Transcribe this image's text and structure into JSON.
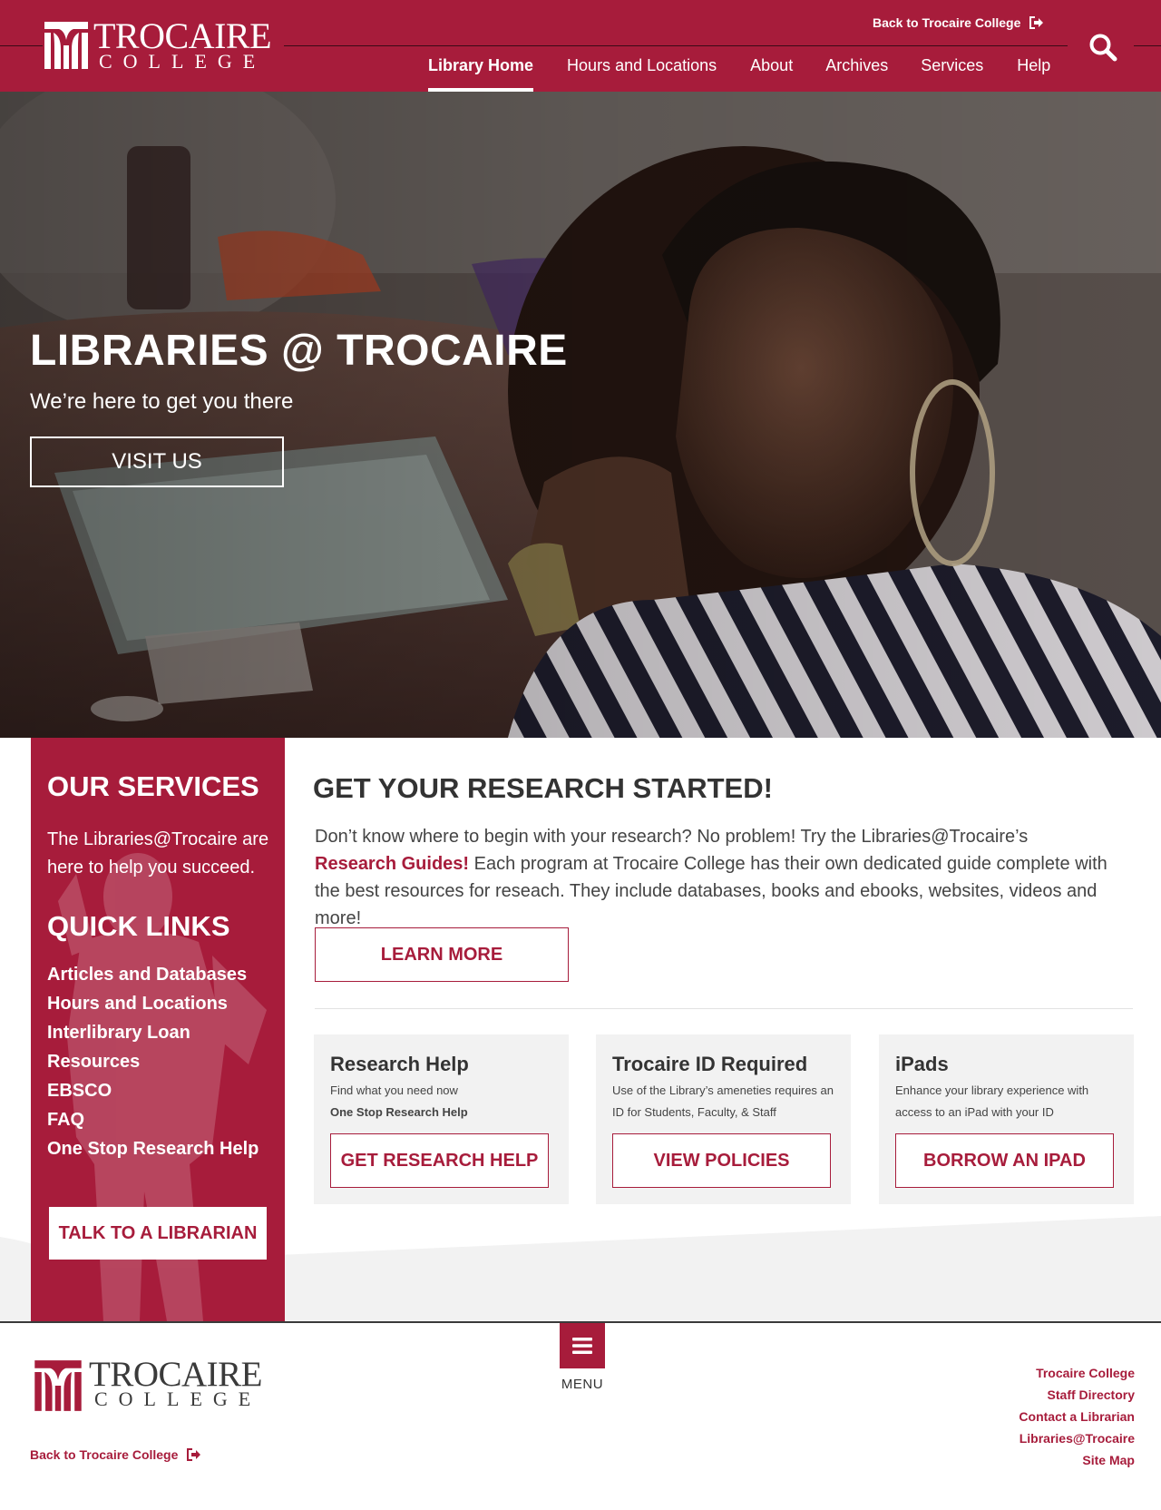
{
  "header": {
    "logo": {
      "word1": "TROCAIRE",
      "word2": "COLLEGE"
    },
    "back_link": "Back to Trocaire College",
    "nav": [
      {
        "label": "Library Home",
        "active": true
      },
      {
        "label": "Hours and Locations"
      },
      {
        "label": "About"
      },
      {
        "label": "Archives"
      },
      {
        "label": "Services"
      },
      {
        "label": "Help"
      }
    ],
    "search_icon": "search-icon"
  },
  "hero": {
    "title": "LIBRARIES @ TROCAIRE",
    "subtitle": "We’re here to get you there",
    "button": "VISIT US"
  },
  "sidebar": {
    "services_heading": "OUR SERVICES",
    "services_text": "The Libraries@Trocaire are here to help you succeed.",
    "quick_links_heading": "QUICK LINKS",
    "quick_links": [
      "Articles and Databases",
      "Hours and Locations",
      "Interlibrary Loan",
      "Resources",
      "EBSCO",
      "FAQ",
      "One Stop Research Help"
    ],
    "button": "TALK TO A LIBRARIAN"
  },
  "main": {
    "heading": "GET YOUR RESEARCH STARTED!",
    "para_before": "Don’t know where to begin with your research? No problem! Try the Libraries@Trocaire’s ",
    "para_link": "Research Guides!",
    "para_after": " Each program at Trocaire College has their own dedicated guide complete with the best resources for reseach. They include databases, books and ebooks, websites, videos and more!",
    "learn_more": "LEARN MORE",
    "cards": [
      {
        "title": "Research Help",
        "desc1": "Find what you need now",
        "desc2": "One Stop Research Help",
        "button": "GET RESEARCH HELP"
      },
      {
        "title": "Trocaire ID Required",
        "desc1": "Use of the Library’s ameneties requires an ID for Students, Faculty, & Staff",
        "button": "VIEW POLICIES"
      },
      {
        "title": "iPads",
        "desc1": "Enhance your library experience with access to an iPad with your ID",
        "button": "BORROW AN IPAD"
      }
    ]
  },
  "footer": {
    "logo": {
      "word1": "TROCAIRE",
      "word2": "COLLEGE"
    },
    "back_link": "Back to Trocaire College",
    "menu_label": "MENU",
    "links": [
      "Trocaire College",
      "Staff Directory",
      "Contact a Librarian",
      "Libraries@Trocaire",
      "Site Map"
    ]
  },
  "colors": {
    "brand": "#a71c3b",
    "dark": "#333333",
    "card_bg": "#f2f2f2"
  }
}
